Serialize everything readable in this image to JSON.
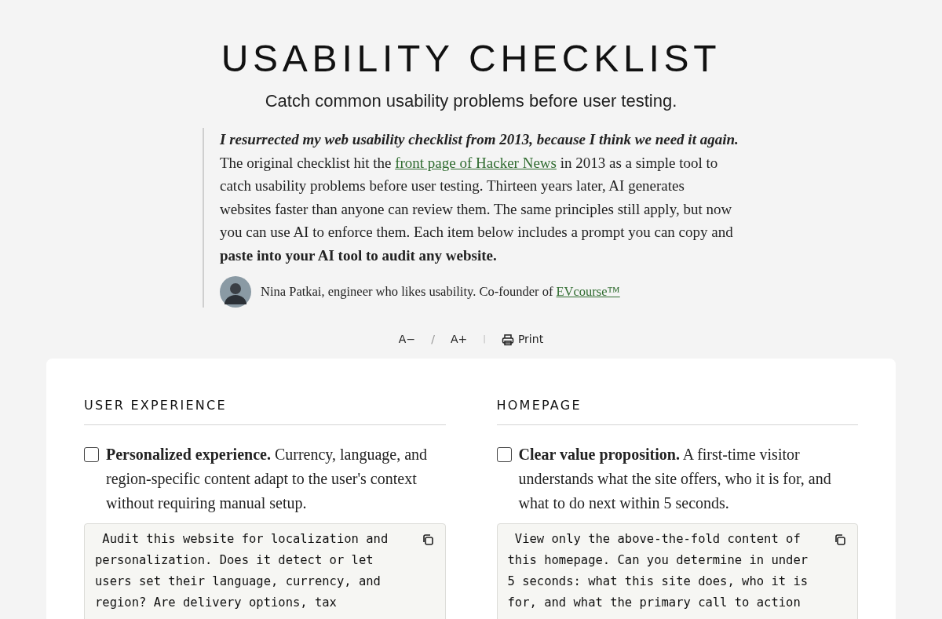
{
  "header": {
    "title": "USABILITY CHECKLIST",
    "subtitle": "Catch common usability problems before user testing."
  },
  "intro": {
    "parts": [
      {
        "kind": "bold_italic",
        "text": "I resurrected my web usability checklist from 2013, because I think we need it again."
      },
      {
        "kind": "text",
        "text": " The original checklist hit the "
      },
      {
        "kind": "link",
        "text": "front page of Hacker News"
      },
      {
        "kind": "text",
        "text": " in 2013 as a simple tool to catch usability problems before user testing. Thirteen years later, AI generates websites faster than anyone can review them. The same principles still apply, but now you can use AI to enforce them. Each item below includes a prompt you can copy and "
      },
      {
        "kind": "bold",
        "text": "paste into your AI tool to audit any website."
      }
    ],
    "author": {
      "text": "Nina Patkai, engineer who likes usability. Co-founder of ",
      "link": "EVcourse™"
    }
  },
  "controls": {
    "decrease": "A−",
    "separator": "/",
    "increase": "A+",
    "divider": "|",
    "print": "Print"
  },
  "sections": [
    {
      "heading": "USER EXPERIENCE",
      "items": [
        {
          "title": "Personalized experience.",
          "description": " Currency, language, and region-specific content adapt to the user's context without requiring manual setup.",
          "checked": false,
          "prompt": " Audit this website for localization and\npersonalization. Does it detect or let\nusers set their language, currency, and\nregion? Are delivery options, tax"
        }
      ]
    },
    {
      "heading": "HOMEPAGE",
      "items": [
        {
          "title": "Clear value proposition.",
          "description": " A first-time visitor understands what the site offers, who it is for, and what to do next within 5 seconds.",
          "checked": false,
          "prompt": " View only the above-the-fold content of\nthis homepage. Can you determine in under\n5 seconds: what this site does, who it is\nfor, and what the primary call to action"
        }
      ]
    }
  ]
}
